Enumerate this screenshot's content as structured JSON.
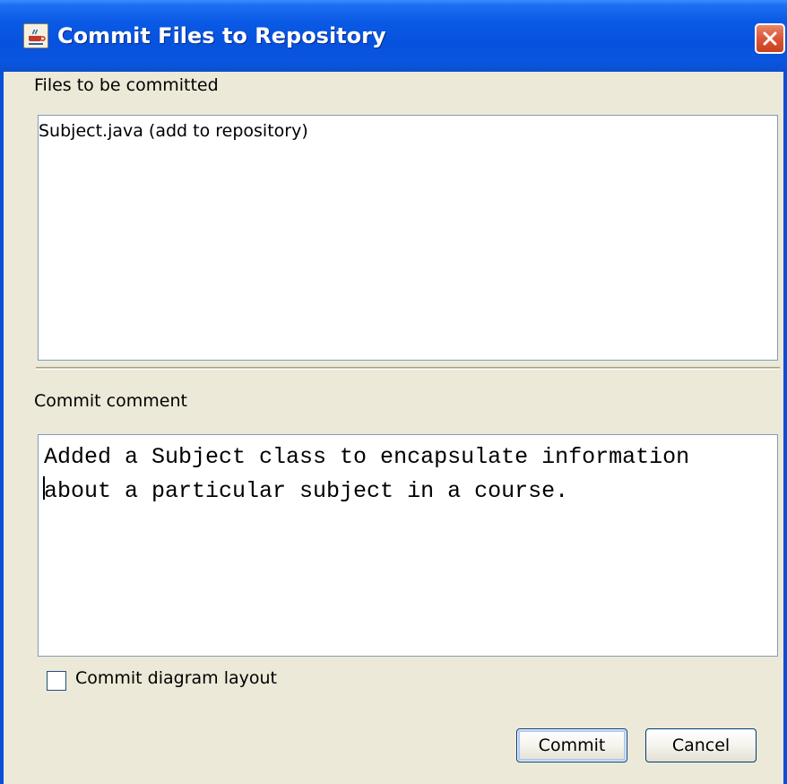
{
  "window": {
    "title": "Commit Files to Repository",
    "app_icon": "java-coffee-cup-icon",
    "close_icon": "close-icon"
  },
  "files_section": {
    "label": "Files to be committed",
    "items": [
      "Subject.java (add to repository)"
    ]
  },
  "comment_section": {
    "label": "Commit comment",
    "lines": [
      "Added a Subject class to encapsulate information",
      "about a particular subject in a course."
    ]
  },
  "options": {
    "commit_layout_label": "Commit diagram layout",
    "commit_layout_checked": false
  },
  "buttons": {
    "commit": "Commit",
    "cancel": "Cancel"
  },
  "colors": {
    "titlebar": "#0a5ae6",
    "window_bg": "#ece9d8",
    "close_button": "#dd5a3a"
  }
}
